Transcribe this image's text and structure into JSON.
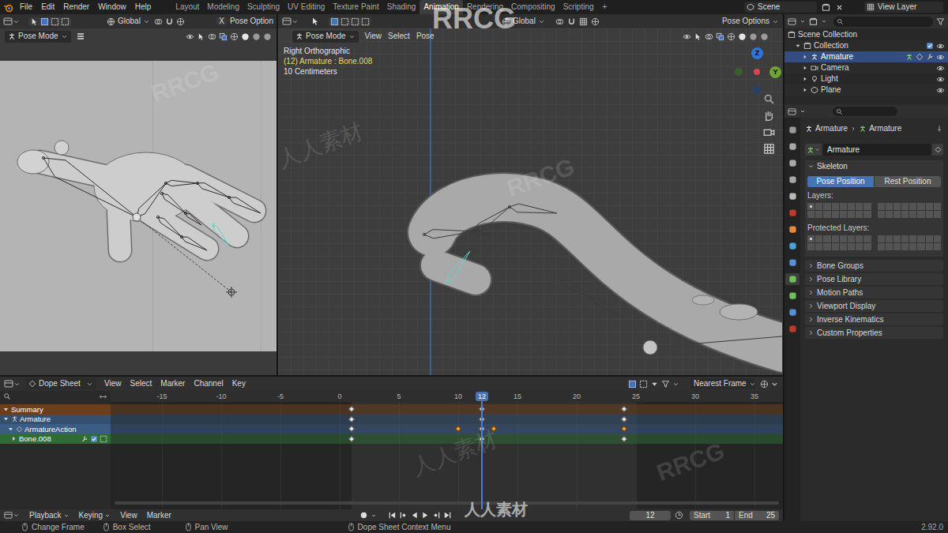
{
  "top_bar": {
    "menus": [
      "File",
      "Edit",
      "Render",
      "Window",
      "Help"
    ],
    "workspaces": [
      {
        "label": "Layout",
        "selected": false
      },
      {
        "label": "Modeling",
        "selected": false
      },
      {
        "label": "Sculpting",
        "selected": false
      },
      {
        "label": "UV Editing",
        "selected": false
      },
      {
        "label": "Texture Paint",
        "selected": false
      },
      {
        "label": "Shading",
        "selected": false
      },
      {
        "label": "Animation",
        "selected": true
      },
      {
        "label": "Rendering",
        "selected": false
      },
      {
        "label": "Compositing",
        "selected": false
      },
      {
        "label": "Scripting",
        "selected": false
      }
    ],
    "add_workspace": "+",
    "scene": "Scene",
    "view_layer": "View Layer"
  },
  "left_viewport": {
    "transform": "Global",
    "mirror": "X",
    "pose_options": "Pose Option",
    "mode": "Pose Mode"
  },
  "main_viewport": {
    "transform": "Global",
    "pose_options": "Pose Options",
    "mode": "Pose Mode",
    "menus": [
      "View",
      "Select",
      "Pose"
    ],
    "overlay": [
      {
        "text": "Right Orthographic",
        "color": "#e4e4e4"
      },
      {
        "text": "(12) Armature : Bone.008",
        "color": "#e6d86a"
      },
      {
        "text": "10 Centimeters",
        "color": "#e4e4e4"
      }
    ],
    "gizmo": [
      {
        "label": "Z",
        "color": "#2f73d9"
      },
      {
        "label": "Y",
        "color": "#6fa334"
      }
    ]
  },
  "outliner": {
    "items": [
      {
        "label": "Scene Collection",
        "level": 0,
        "kind": "scene",
        "selected": false
      },
      {
        "label": "Collection",
        "level": 1,
        "kind": "collection",
        "expanded": true,
        "selected": false,
        "checked": true,
        "visible": true
      },
      {
        "label": "Armature",
        "level": 2,
        "kind": "armature",
        "expanded": false,
        "selected": true,
        "visible": true
      },
      {
        "label": "Camera",
        "level": 2,
        "kind": "camera",
        "expanded": false,
        "selected": false,
        "visible": true
      },
      {
        "label": "Light",
        "level": 2,
        "kind": "light",
        "expanded": false,
        "selected": false,
        "visible": true
      },
      {
        "label": "Plane",
        "level": 2,
        "kind": "mesh",
        "expanded": false,
        "selected": false,
        "visible": true
      }
    ]
  },
  "properties": {
    "tabs": [
      {
        "kind": "tool",
        "selected": false
      },
      {
        "kind": "render",
        "selected": false
      },
      {
        "kind": "output",
        "selected": false
      },
      {
        "kind": "view_layer",
        "selected": false
      },
      {
        "kind": "scene",
        "selected": false
      },
      {
        "kind": "world",
        "selected": false
      },
      {
        "kind": "object",
        "selected": false
      },
      {
        "kind": "physics",
        "selected": false
      },
      {
        "kind": "constraints",
        "selected": false
      },
      {
        "kind": "data",
        "selected": true
      },
      {
        "kind": "bone",
        "selected": false
      },
      {
        "kind": "bone_constraints",
        "selected": false
      },
      {
        "kind": "texture",
        "selected": false
      }
    ],
    "breadcrumb": [
      "Armature",
      "Armature"
    ],
    "name": "Armature",
    "panel": {
      "label": "Skeleton",
      "expanded": true
    },
    "position_buttons": [
      {
        "label": "Pose Position",
        "selected": true
      },
      {
        "label": "Rest Position",
        "selected": false
      }
    ],
    "layers_label": "Layers:",
    "layers": [
      true,
      false,
      false,
      false,
      false,
      false,
      false,
      false,
      false,
      false,
      false,
      false,
      false,
      false,
      false,
      false,
      false,
      false,
      false,
      false,
      false,
      false,
      false,
      false,
      false,
      false,
      false,
      false,
      false,
      false,
      false,
      false
    ],
    "protected_label": "Protected Layers:",
    "protected_layers": [
      true,
      false,
      false,
      false,
      false,
      false,
      false,
      false,
      false,
      false,
      false,
      false,
      false,
      false,
      false,
      false,
      false,
      false,
      false,
      false,
      false,
      false,
      false,
      false,
      false,
      false,
      false,
      false,
      false,
      false,
      false,
      false
    ],
    "collapsed": [
      {
        "label": "Bone Groups",
        "expanded": false
      },
      {
        "label": "Pose Library",
        "expanded": false
      },
      {
        "label": "Motion Paths",
        "expanded": false
      },
      {
        "label": "Viewport Display",
        "expanded": false
      },
      {
        "label": "Inverse Kinematics",
        "expanded": false
      },
      {
        "label": "Custom Properties",
        "expanded": false
      }
    ]
  },
  "dope_sheet": {
    "editor": "Dope Sheet",
    "menus": [
      "View",
      "Select",
      "Marker",
      "Channel",
      "Key"
    ],
    "snap": "Nearest Frame",
    "ticks": [
      {
        "label": "-15",
        "frame": -15
      },
      {
        "label": "-10",
        "frame": -10
      },
      {
        "label": "-5",
        "frame": -5
      },
      {
        "label": "0",
        "frame": 0
      },
      {
        "label": "5",
        "frame": 5
      },
      {
        "label": "10",
        "frame": 10
      },
      {
        "label": "15",
        "frame": 15
      },
      {
        "label": "20",
        "frame": 20
      },
      {
        "label": "25",
        "frame": 25
      },
      {
        "label": "30",
        "frame": 30
      },
      {
        "label": "35",
        "frame": 35
      }
    ],
    "current_frame": {
      "label": "12",
      "frame": 12
    },
    "range": {
      "start": 1,
      "end": 25
    },
    "channels": [
      {
        "label": "Summary",
        "kind": "summary",
        "color": "#6b3f1d",
        "expanded": true,
        "keys": [
          {
            "frame": 1,
            "selected": false
          },
          {
            "frame": 12,
            "selected": false
          },
          {
            "frame": 24,
            "selected": false
          }
        ]
      },
      {
        "label": "Armature",
        "kind": "object",
        "color": "#34506e",
        "expanded": true,
        "keys": [
          {
            "frame": 1,
            "selected": false
          },
          {
            "frame": 12,
            "selected": false
          },
          {
            "frame": 24,
            "selected": false
          }
        ]
      },
      {
        "label": "ArmatureAction",
        "kind": "action",
        "color": "#3b5c85",
        "expanded": true,
        "keys": [
          {
            "frame": 1,
            "selected": false
          },
          {
            "frame": 10,
            "selected": true
          },
          {
            "frame": 12,
            "selected": false
          },
          {
            "frame": 13,
            "selected": true
          },
          {
            "frame": 24,
            "selected": true
          }
        ]
      },
      {
        "label": "Bone.008",
        "kind": "group",
        "color": "#2f6b34",
        "expanded": false,
        "checked": true,
        "keys": [
          {
            "frame": 1,
            "selected": false
          },
          {
            "frame": 12,
            "selected": false
          },
          {
            "frame": 24,
            "selected": false
          }
        ]
      }
    ]
  },
  "timeline": {
    "menus": [
      "Playback",
      "Keying",
      "View",
      "Marker"
    ],
    "frame": "12",
    "start_label": "Start",
    "start": "1",
    "end_label": "End",
    "end": "25"
  },
  "status_bar": {
    "hints": [
      "Change Frame",
      "Box Select",
      "Pan View",
      "Dope Sheet Context Menu"
    ],
    "version": "2.92.0"
  },
  "watermarks": [
    "RRCG",
    "人人素材",
    "RRCG",
    "人人素材",
    "RRCG",
    "人人素材",
    "RRCG"
  ]
}
